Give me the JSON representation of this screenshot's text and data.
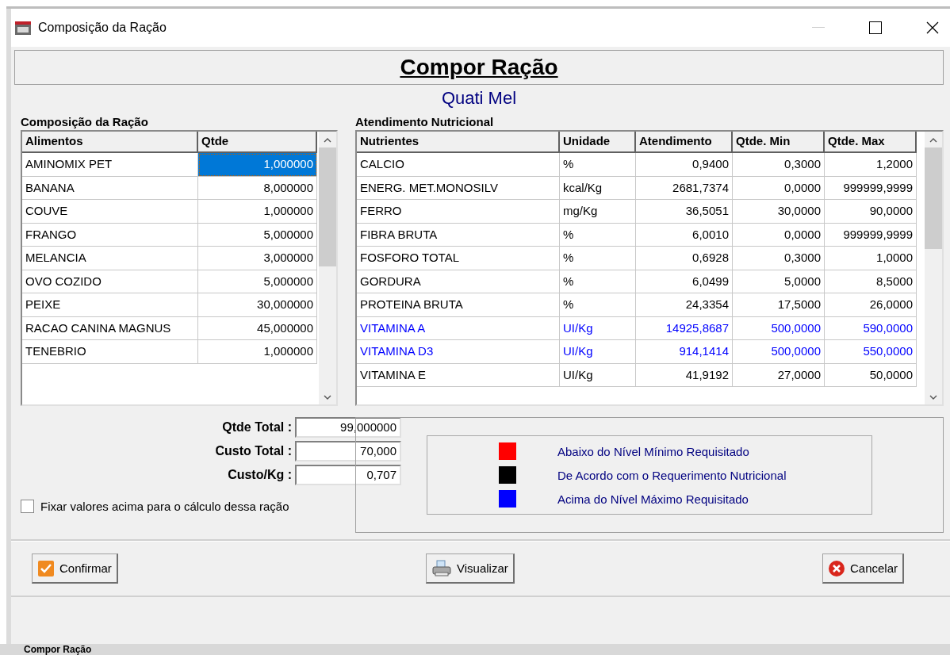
{
  "window": {
    "title": "Composição da Ração"
  },
  "heading": "Compor Ração",
  "subtitle": "Quati Mel",
  "composition": {
    "title": "Composição da Ração",
    "columns": [
      "Alimentos",
      "Qtde"
    ],
    "rows": [
      {
        "food": "AMINOMIX PET",
        "qty": "1,000000",
        "selected": true
      },
      {
        "food": "BANANA",
        "qty": "8,000000",
        "selected": false
      },
      {
        "food": "COUVE",
        "qty": "1,000000",
        "selected": false
      },
      {
        "food": "FRANGO",
        "qty": "5,000000",
        "selected": false
      },
      {
        "food": "MELANCIA",
        "qty": "3,000000",
        "selected": false
      },
      {
        "food": "OVO COZIDO",
        "qty": "5,000000",
        "selected": false
      },
      {
        "food": "PEIXE",
        "qty": "30,000000",
        "selected": false
      },
      {
        "food": "RACAO CANINA MAGNUS",
        "qty": "45,000000",
        "selected": false
      },
      {
        "food": "TENEBRIO",
        "qty": "1,000000",
        "selected": false
      }
    ]
  },
  "totals": [
    {
      "label": "Qtde Total :",
      "value": "99,000000"
    },
    {
      "label": "Custo Total :",
      "value": "70,000"
    },
    {
      "label": "Custo/Kg :",
      "value": "0,707"
    }
  ],
  "fix_values": {
    "label": "Fixar valores acima para o cálculo dessa ração",
    "checked": false
  },
  "nutrition": {
    "title": "Atendimento Nutricional",
    "columns": [
      "Nutrientes",
      "Unidade",
      "Atendimento",
      "Qtde. Min",
      "Qtde. Max"
    ],
    "rows": [
      {
        "cells": [
          "CALCIO",
          "%",
          "0,9400",
          "0,3000",
          "1,2000"
        ],
        "color": "#000000"
      },
      {
        "cells": [
          "ENERG. MET.MONOSILV",
          "kcal/Kg",
          "2681,7374",
          "0,0000",
          "999999,9999"
        ],
        "color": "#000000"
      },
      {
        "cells": [
          "FERRO",
          "mg/Kg",
          "36,5051",
          "30,0000",
          "90,0000"
        ],
        "color": "#000000"
      },
      {
        "cells": [
          "FIBRA BRUTA",
          "%",
          "6,0010",
          "0,0000",
          "999999,9999"
        ],
        "color": "#000000"
      },
      {
        "cells": [
          "FOSFORO TOTAL",
          "%",
          "0,6928",
          "0,3000",
          "1,0000"
        ],
        "color": "#000000"
      },
      {
        "cells": [
          "GORDURA",
          "%",
          "6,0499",
          "5,0000",
          "8,5000"
        ],
        "color": "#000000"
      },
      {
        "cells": [
          "PROTEINA BRUTA",
          "%",
          "24,3354",
          "17,5000",
          "26,0000"
        ],
        "color": "#000000"
      },
      {
        "cells": [
          "VITAMINA A",
          "UI/Kg",
          "14925,8687",
          "500,0000",
          "590,0000"
        ],
        "color": "#0000ff"
      },
      {
        "cells": [
          "VITAMINA D3",
          "UI/Kg",
          "914,1414",
          "500,0000",
          "550,0000"
        ],
        "color": "#0000ff"
      },
      {
        "cells": [
          "VITAMINA E",
          "UI/Kg",
          "41,9192",
          "27,0000",
          "50,0000"
        ],
        "color": "#000000"
      }
    ]
  },
  "legend": [
    {
      "label": "Abaixo do Nível Mínimo Requisitado",
      "color": "#ff0000"
    },
    {
      "label": "De Acordo com o Requerimento Nutricional",
      "color": "#000000"
    },
    {
      "label": "Acima do Nível Máximo Requisitado",
      "color": "#0000ff"
    }
  ],
  "buttons": [
    {
      "kind": "confirm",
      "label": "Confirmar"
    },
    {
      "kind": "preview",
      "label": "Visualizar"
    },
    {
      "kind": "cancel",
      "label": "Cancelar"
    }
  ],
  "background_window": {
    "title": "Compor Ração"
  }
}
